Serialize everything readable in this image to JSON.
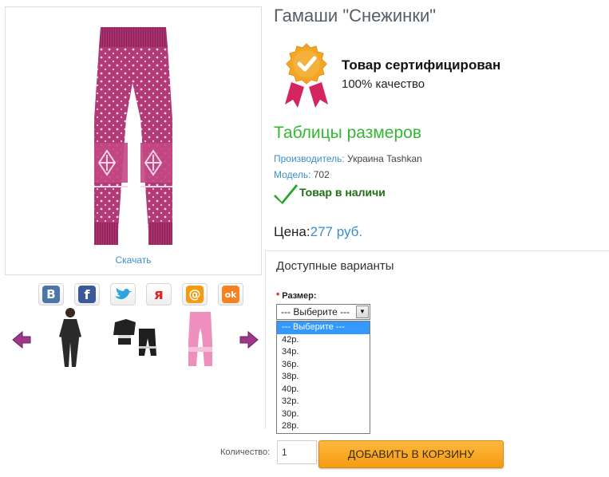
{
  "product": {
    "title": "Гамаши \"Снежинки\"",
    "download_label": "Скачать",
    "certified_title": "Товар сертифицирован",
    "certified_sub": "100% качество",
    "size_table_link": "Таблицы размеров",
    "manufacturer_label": "Производитель:",
    "manufacturer_value": "Украина Tashkan",
    "model_label": "Модель:",
    "model_value": "702",
    "stock_text": "Товар в наличи",
    "price_label": "Цена:",
    "price_value": "277 руб."
  },
  "social": [
    {
      "icon": "vk-icon",
      "glyph": "B",
      "color": "#4a76a8"
    },
    {
      "icon": "facebook-icon",
      "glyph": "f",
      "color": "#3b5998"
    },
    {
      "icon": "twitter-icon",
      "glyph": "t",
      "color": "#2ea5e0"
    },
    {
      "icon": "yaru-icon",
      "glyph": "я",
      "color": "#e02020"
    },
    {
      "icon": "mailru-icon",
      "glyph": "@",
      "color": "#f39c12"
    },
    {
      "icon": "odnoklassniki-icon",
      "glyph": "ok",
      "color": "#f58220"
    }
  ],
  "variants": {
    "title": "Доступные варианты",
    "size_required_mark": "*",
    "size_label": "Размер:",
    "selected": "--- Выберите ---",
    "options": [
      "--- Выберите ---",
      "42р.",
      "34р.",
      "36р.",
      "38р.",
      "40р.",
      "32р.",
      "30р.",
      "28р."
    ]
  },
  "cart": {
    "qty_label": "Количество:",
    "qty_value": "1",
    "add_button": "ДОБАВИТЬ В КОРЗИНУ"
  },
  "colors": {
    "accent_blue": "#3a8fc8",
    "green_link": "#33b833",
    "stock_green": "#1e6e16",
    "button_orange": "#f49b12",
    "select_highlight": "#3399ff"
  }
}
